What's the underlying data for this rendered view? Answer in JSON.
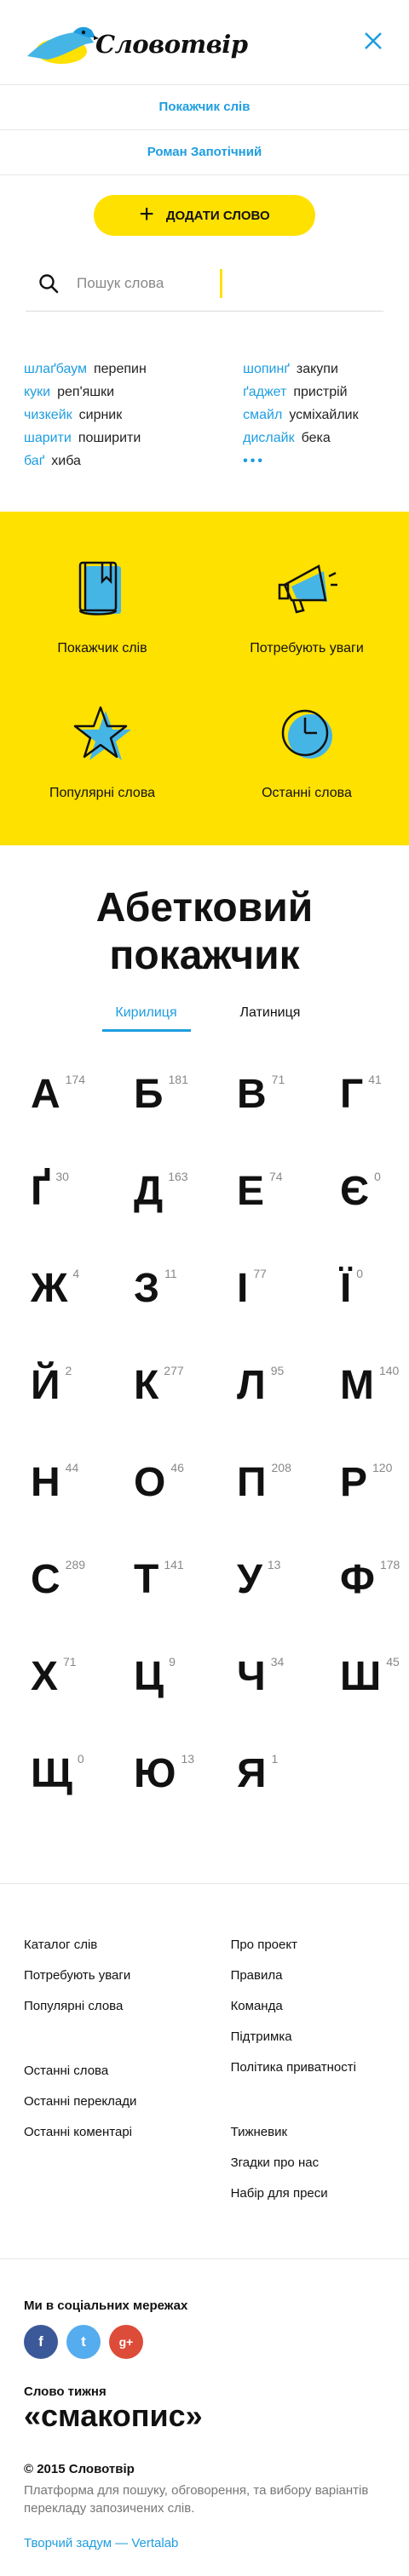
{
  "header": {
    "logo_text": "Словотвір",
    "close_icon": "close-icon",
    "brand_color": "#ffe100",
    "link_color": "#1e9de0"
  },
  "nav": {
    "index_label": "Покажчик слів",
    "user_label": "Роман Запотічний"
  },
  "add_button": {
    "label": "ДОДАТИ СЛОВО",
    "icon": "plus-icon"
  },
  "search": {
    "placeholder": "Пошук слова",
    "value": ""
  },
  "pairs_left": [
    {
      "word": "шлаґбаум",
      "translation": "перепин"
    },
    {
      "word": "куки",
      "translation": "реп'яшки"
    },
    {
      "word": "чизкейк",
      "translation": "сирник"
    },
    {
      "word": "шарити",
      "translation": "поширити"
    },
    {
      "word": "баґ",
      "translation": "хиба"
    }
  ],
  "pairs_right": [
    {
      "word": "шопинґ",
      "translation": "закупи"
    },
    {
      "word": "ґаджет",
      "translation": "пристрій"
    },
    {
      "word": "смайл",
      "translation": "усміхайлик"
    },
    {
      "word": "дислайк",
      "translation": "бека"
    }
  ],
  "more_label": "•••",
  "tiles": [
    {
      "label": "Покажчик слів",
      "icon": "book-icon"
    },
    {
      "label": "Потребують уваги",
      "icon": "megaphone-icon"
    },
    {
      "label": "Популярні слова",
      "icon": "star-icon"
    },
    {
      "label": "Останні слова",
      "icon": "clock-icon"
    }
  ],
  "alphabet": {
    "title_line1": "Абетковий",
    "title_line2": "покажчик",
    "tabs": [
      "Кирилиця",
      "Латиниця"
    ],
    "active_tab": "Кирилиця",
    "letters": [
      {
        "ch": "А",
        "count": "174"
      },
      {
        "ch": "Б",
        "count": "181"
      },
      {
        "ch": "В",
        "count": "71"
      },
      {
        "ch": "Г",
        "count": "41"
      },
      {
        "ch": "Ґ",
        "count": "30"
      },
      {
        "ch": "Д",
        "count": "163"
      },
      {
        "ch": "Е",
        "count": "74"
      },
      {
        "ch": "Є",
        "count": "0"
      },
      {
        "ch": "Ж",
        "count": "4"
      },
      {
        "ch": "З",
        "count": "11"
      },
      {
        "ch": "І",
        "count": "77"
      },
      {
        "ch": "Ї",
        "count": "0"
      },
      {
        "ch": "Й",
        "count": "2"
      },
      {
        "ch": "К",
        "count": "277"
      },
      {
        "ch": "Л",
        "count": "95"
      },
      {
        "ch": "М",
        "count": "140"
      },
      {
        "ch": "Н",
        "count": "44"
      },
      {
        "ch": "О",
        "count": "46"
      },
      {
        "ch": "П",
        "count": "208"
      },
      {
        "ch": "Р",
        "count": "120"
      },
      {
        "ch": "С",
        "count": "289"
      },
      {
        "ch": "Т",
        "count": "141"
      },
      {
        "ch": "У",
        "count": "13"
      },
      {
        "ch": "Ф",
        "count": "178"
      },
      {
        "ch": "Х",
        "count": "71"
      },
      {
        "ch": "Ц",
        "count": "9"
      },
      {
        "ch": "Ч",
        "count": "34"
      },
      {
        "ch": "Ш",
        "count": "45"
      },
      {
        "ch": "Щ",
        "count": "0"
      },
      {
        "ch": "Ю",
        "count": "13"
      },
      {
        "ch": "Я",
        "count": "1"
      }
    ]
  },
  "footer": {
    "left": [
      [
        "Каталог слів",
        "Потребують уваги",
        "Популярні слова"
      ],
      [
        "Останні слова",
        "Останні переклади",
        "Останні коментарі"
      ]
    ],
    "right": [
      [
        "Про проект",
        "Правила",
        "Команда",
        "Підтримка",
        "Політика приватності"
      ],
      [
        "Тижневик",
        "Згадки про нас",
        "Набір для преси"
      ]
    ]
  },
  "social": {
    "title": "Ми в соціальних мережах",
    "facebook": "f",
    "twitter": "t",
    "googleplus": "g+"
  },
  "word_of_week": {
    "label": "Слово тижня",
    "word": "«смакопис»"
  },
  "copyright": {
    "text": "© 2015 Словотвір",
    "description": "Платформа для пошуку, обговорення, та вибору варіантів перекладу запозичених слів.",
    "credit": "Творчий задум — Vertalab"
  }
}
